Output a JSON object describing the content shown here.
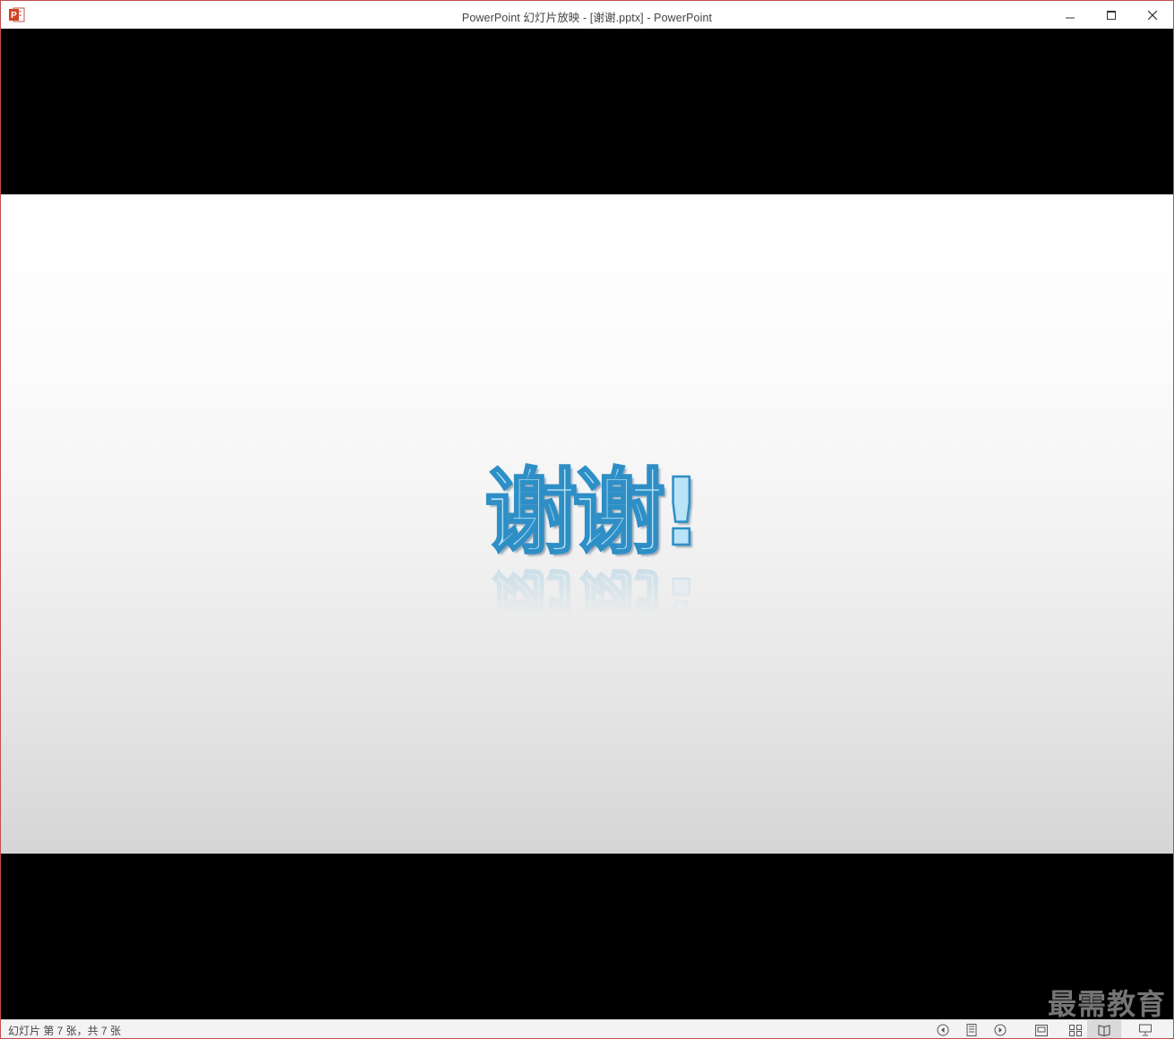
{
  "window": {
    "title": "PowerPoint 幻灯片放映 - [谢谢.pptx] - PowerPoint",
    "app_icon": "powerpoint-icon",
    "controls": {
      "minimize": "minimize-icon",
      "maximize": "maximize-icon",
      "close": "close-icon"
    }
  },
  "slide": {
    "title_text": "谢谢!",
    "colors": {
      "text_fill": "#b9e3f7",
      "text_outline": "#2e8fc6",
      "background_top": "#ffffff",
      "background_bottom": "#d6d6d6",
      "letterbox": "#000000"
    }
  },
  "watermark": {
    "text": "最需教育"
  },
  "statusbar": {
    "slide_info": "幻灯片 第 7 张，共 7 张",
    "icons": [
      "previous-icon",
      "notes-icon",
      "next-icon",
      "normal-view-icon",
      "slide-sorter-icon",
      "reading-view-icon",
      "slideshow-icon"
    ]
  }
}
